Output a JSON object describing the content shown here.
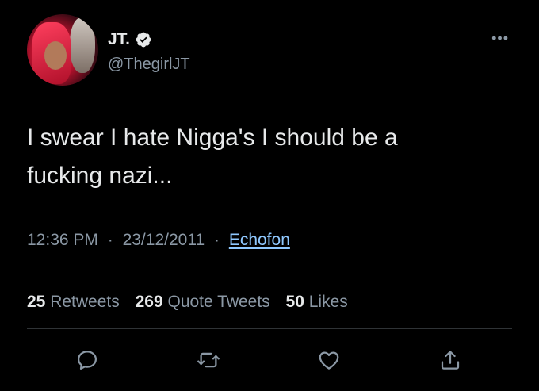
{
  "user": {
    "display_name": "JT.",
    "handle": "@ThegirlJT",
    "verified": true
  },
  "tweet": {
    "text_line1": "I swear I hate Nigga's I should be a",
    "text_line2": "fucking nazi...",
    "time": "12:36 PM",
    "separator": "·",
    "date": "23/12/2011",
    "source": "Echofon"
  },
  "stats": {
    "retweets_count": "25",
    "retweets_label": "Retweets",
    "quotes_count": "269",
    "quotes_label": "Quote Tweets",
    "likes_count": "50",
    "likes_label": "Likes"
  },
  "menu": {
    "more_glyph": "•••"
  },
  "icons": [
    "reply-icon",
    "retweet-icon",
    "like-icon",
    "share-icon",
    "verified-badge-icon",
    "more-options-icon"
  ],
  "colors": {
    "background": "#000000",
    "text": "#e7e9ea",
    "secondary": "#8b98a5",
    "link": "#8fc8ff",
    "divider": "#2f3336"
  }
}
